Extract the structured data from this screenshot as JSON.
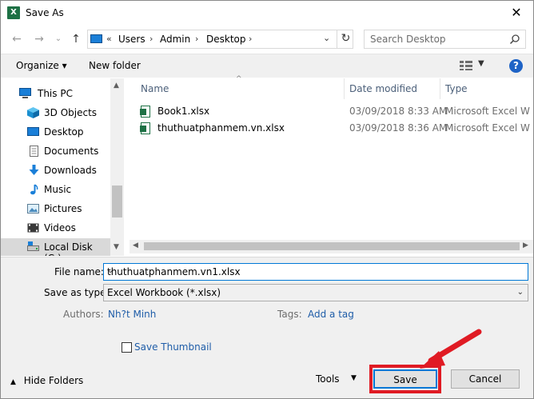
{
  "window": {
    "title": "Save As",
    "app_icon_letter": "X",
    "close_glyph": "✕"
  },
  "address_bar": {
    "segments": [
      "«",
      "Users",
      "›",
      "Admin",
      "›",
      "Desktop",
      "›"
    ],
    "search_placeholder": "Search Desktop"
  },
  "toolbar": {
    "organize": "Organize ▾",
    "new_folder": "New folder",
    "help": "?"
  },
  "nav_pane": {
    "items": [
      {
        "label": "This PC",
        "icon": "pc-icon"
      },
      {
        "label": "3D Objects",
        "icon": "cube-icon"
      },
      {
        "label": "Desktop",
        "icon": "desktop-icon"
      },
      {
        "label": "Documents",
        "icon": "documents-icon"
      },
      {
        "label": "Downloads",
        "icon": "downloads-icon"
      },
      {
        "label": "Music",
        "icon": "music-icon"
      },
      {
        "label": "Pictures",
        "icon": "pictures-icon"
      },
      {
        "label": "Videos",
        "icon": "videos-icon"
      },
      {
        "label": "Local Disk (C:)",
        "icon": "disk-icon"
      }
    ]
  },
  "file_list": {
    "columns": [
      "Name",
      "Date modified",
      "Type"
    ],
    "rows": [
      {
        "name": "Book1.xlsx",
        "date": "03/09/2018 8:33 AM",
        "type": "Microsoft Excel W"
      },
      {
        "name": "thuthuatphanmem.vn.xlsx",
        "date": "03/09/2018 8:36 AM",
        "type": "Microsoft Excel W"
      }
    ]
  },
  "form": {
    "file_name_label": "File name:",
    "file_name_value": "thuthuatphanmem.vn1.xlsx",
    "save_as_type_label": "Save as type:",
    "save_as_type_value": "Excel Workbook (*.xlsx)",
    "authors_label": "Authors:",
    "authors_value": "Nh?t Minh",
    "tags_label": "Tags:",
    "tags_value": "Add a tag",
    "save_thumbnail_label": "Save Thumbnail"
  },
  "footer": {
    "hide_folders": "Hide Folders",
    "tools": "Tools",
    "save": "Save",
    "cancel": "Cancel"
  },
  "colors": {
    "highlight": "#e01b24",
    "accent": "#0078d7",
    "excel_green": "#1e7145"
  }
}
